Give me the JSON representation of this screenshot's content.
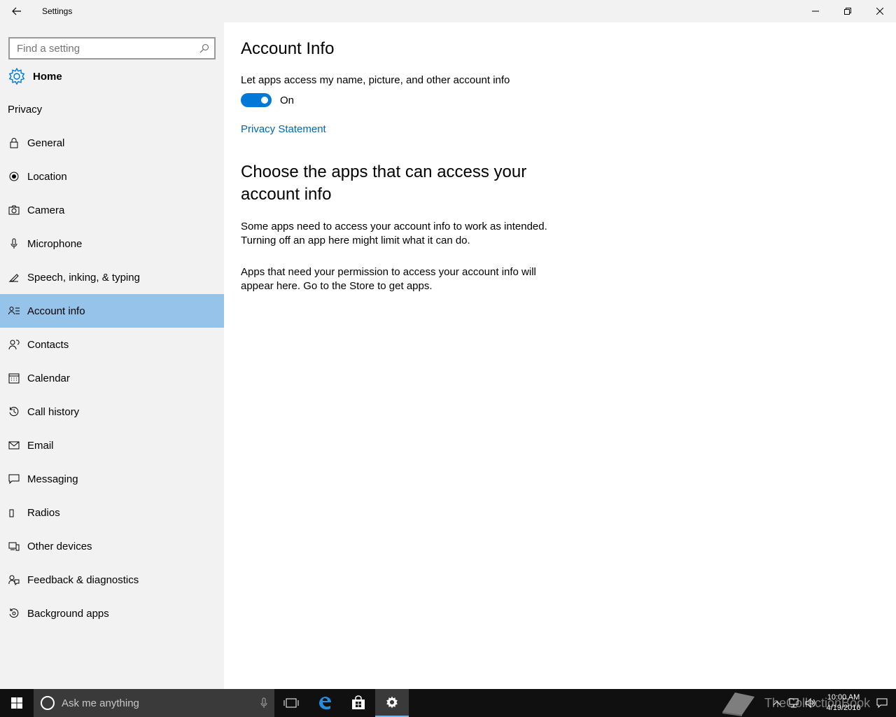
{
  "window": {
    "title": "Settings",
    "back_icon": "back-arrow-icon",
    "controls": [
      "minimize-icon",
      "restore-icon",
      "close-icon"
    ]
  },
  "sidebar": {
    "search_placeholder": "Find a setting",
    "home_label": "Home",
    "section_label": "Privacy",
    "items": [
      {
        "label": "General",
        "icon": "lock-icon",
        "selected": false
      },
      {
        "label": "Location",
        "icon": "location-icon",
        "selected": false
      },
      {
        "label": "Camera",
        "icon": "camera-icon",
        "selected": false
      },
      {
        "label": "Microphone",
        "icon": "microphone-icon",
        "selected": false
      },
      {
        "label": "Speech, inking, & typing",
        "icon": "speech-icon",
        "selected": false
      },
      {
        "label": "Account info",
        "icon": "account-info-icon",
        "selected": true
      },
      {
        "label": "Contacts",
        "icon": "contacts-icon",
        "selected": false
      },
      {
        "label": "Calendar",
        "icon": "calendar-icon",
        "selected": false
      },
      {
        "label": "Call history",
        "icon": "history-icon",
        "selected": false
      },
      {
        "label": "Email",
        "icon": "email-icon",
        "selected": false
      },
      {
        "label": "Messaging",
        "icon": "message-icon",
        "selected": false
      },
      {
        "label": "Radios",
        "icon": "radio-icon",
        "selected": false
      },
      {
        "label": "Other devices",
        "icon": "devices-icon",
        "selected": false
      },
      {
        "label": "Feedback & diagnostics",
        "icon": "feedback-icon",
        "selected": false
      },
      {
        "label": "Background apps",
        "icon": "background-apps-icon",
        "selected": false
      }
    ]
  },
  "main": {
    "title": "Account Info",
    "toggle_description": "Let apps access my name, picture, and other account info",
    "toggle_state": "On",
    "privacy_link": "Privacy Statement",
    "section_title": "Choose the apps that can access your account info",
    "paragraph1": "Some apps need to access your account info to work as intended. Turning off an app here might limit what it can do.",
    "paragraph2": "Apps that need your permission to access your account info will appear here. Go to the Store to get apps."
  },
  "taskbar": {
    "cortana_placeholder": "Ask me anything",
    "time": "10:00 AM",
    "date": "4/19/2016",
    "watermark": "TheCollectionBook"
  },
  "colors": {
    "accent": "#0078d7",
    "selected_bg": "#95c3ea",
    "link": "#0067b8",
    "sidebar_bg": "#f2f2f2",
    "taskbar_bg": "#101010"
  }
}
